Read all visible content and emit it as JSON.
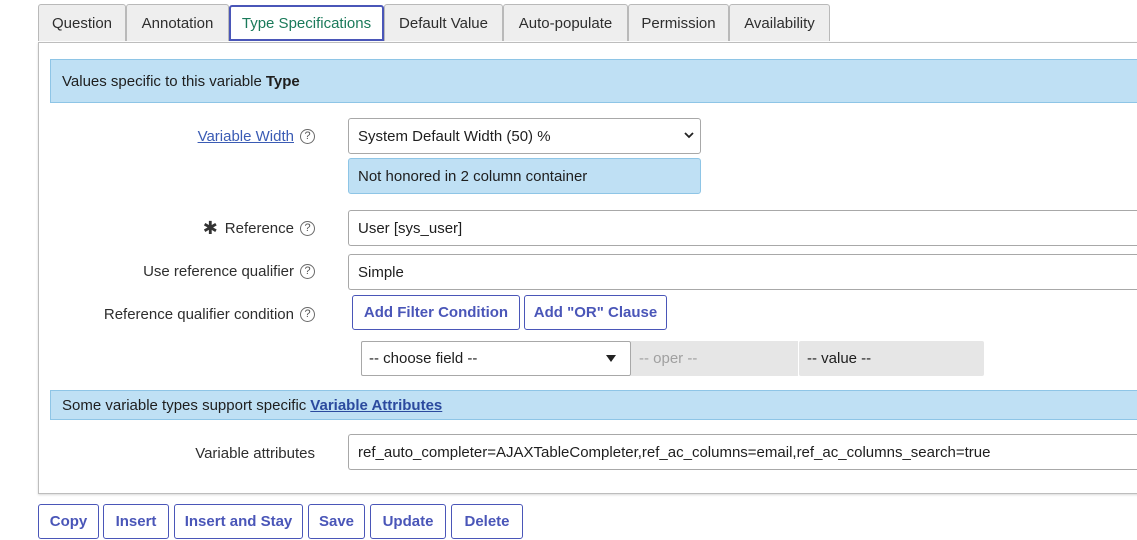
{
  "tabs": [
    {
      "label": "Question"
    },
    {
      "label": "Annotation"
    },
    {
      "label": "Type Specifications"
    },
    {
      "label": "Default Value"
    },
    {
      "label": "Auto-populate"
    },
    {
      "label": "Permission"
    },
    {
      "label": "Availability"
    }
  ],
  "active_tab": "Type Specifications",
  "banner_type": {
    "prefix": "Values specific to this variable",
    "bold": "Type"
  },
  "variable_width": {
    "label": "Variable Width",
    "value": "System Default Width (50) %",
    "notice": "Not honored in 2 column container"
  },
  "reference": {
    "label": "Reference",
    "value": "User [sys_user]",
    "required_mark": "✱"
  },
  "use_ref_qualifier": {
    "label": "Use reference qualifier",
    "value": "Simple"
  },
  "ref_qualifier_condition": {
    "label": "Reference qualifier condition",
    "add_filter": "Add Filter Condition",
    "add_or": "Add \"OR\" Clause",
    "choose_field": "-- choose field --",
    "oper": "-- oper --",
    "value": "-- value --"
  },
  "banner_attributes": {
    "prefix": "Some variable types support specific",
    "link": "Variable Attributes"
  },
  "variable_attributes": {
    "label": "Variable attributes",
    "value": "ref_auto_completer=AJAXTableCompleter,ref_ac_columns=email,ref_ac_columns_search=true"
  },
  "actions": {
    "copy": "Copy",
    "insert": "Insert",
    "insert_stay": "Insert and Stay",
    "save": "Save",
    "update": "Update",
    "delete": "Delete"
  },
  "help_glyph": "?",
  "colors": {
    "accent": "#4a56b8",
    "banner_bg": "#bfe0f4",
    "active_tab_text": "#1a7a5a"
  }
}
